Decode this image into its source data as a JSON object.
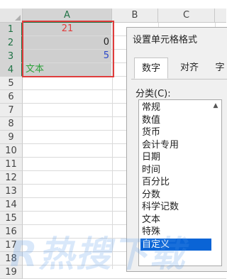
{
  "spreadsheet": {
    "columns": [
      "A",
      "B",
      "C"
    ],
    "rows": [
      "1",
      "2",
      "3",
      "4",
      "5",
      "6",
      "7",
      "8",
      "9",
      "10",
      "11",
      "12",
      "13",
      "14",
      "15",
      "16",
      "17",
      "18",
      "19"
    ],
    "cells": {
      "a1": {
        "value": "21",
        "color": "#e03c3c"
      },
      "a2": {
        "value": "0",
        "color": "#222222"
      },
      "a3": {
        "value": "5",
        "color": "#2b47c8"
      },
      "a4": {
        "value": "文本",
        "color": "#2ea23b"
      }
    }
  },
  "dialog": {
    "title": "设置单元格格式",
    "tabs": [
      "数字",
      "对齐",
      "字"
    ],
    "category_label": "分类(C):",
    "categories": [
      "常规",
      "数值",
      "货币",
      "会计专用",
      "日期",
      "时间",
      "百分比",
      "分数",
      "科学记数",
      "文本",
      "特殊",
      "自定义"
    ],
    "selected_category": "自定义"
  },
  "watermark": {
    "text": "R热搜下载"
  }
}
